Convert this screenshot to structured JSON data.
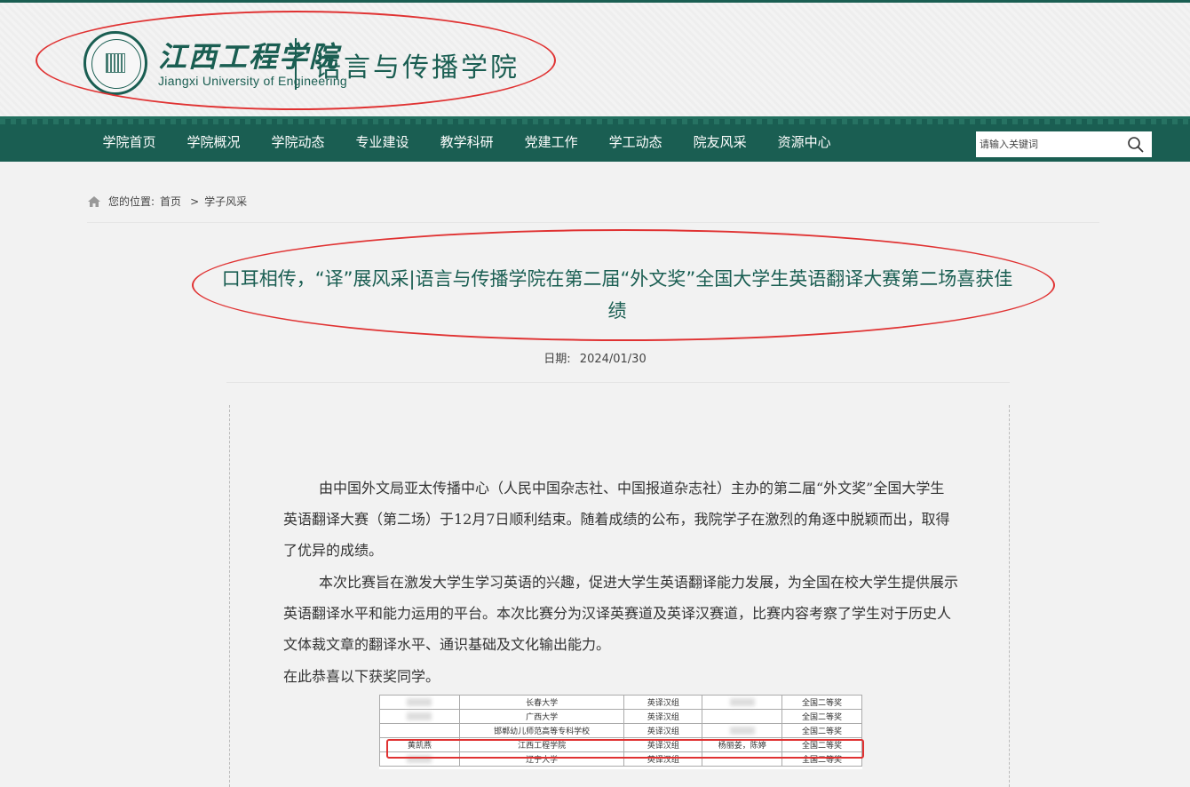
{
  "header": {
    "university_cn": "江西工程学院",
    "university_en": "Jiangxi University of Engineering",
    "college_name": "语言与传播学院"
  },
  "nav": {
    "items": [
      "学院首页",
      "学院概况",
      "学院动态",
      "专业建设",
      "教学科研",
      "党建工作",
      "学工动态",
      "院友风采",
      "资源中心"
    ]
  },
  "search": {
    "placeholder": "请输入关键词"
  },
  "breadcrumb": {
    "label": "您的位置:",
    "home": "首页",
    "separator": ">",
    "current": "学子风采"
  },
  "article": {
    "title": "口耳相传，“译”展风采|语言与传播学院在第二届“外文奖”全国大学生英语翻译大赛第二场喜获佳绩",
    "date_label": "日期:",
    "date": "2024/01/30",
    "paragraphs": [
      "由中国外文局亚太传播中心（人民中国杂志社、中国报道杂志社）主办的第二届“外文奖”全国大学生英语翻译大赛（第二场）于12月7日顺利结束。随着成绩的公布，我院学子在激烈的角逐中脱颖而出，取得了优异的成绩。",
      "本次比赛旨在激发大学生学习英语的兴趣，促进大学生英语翻译能力发展，为全国在校大学生提供展示英语翻译水平和能力运用的平台。本次比赛分为汉译英赛道及英译汉赛道，比赛内容考察了学生对于历史人文体裁文章的翻译水平、通识基础及文化输出能力。",
      "在此恭喜以下获奖同学。"
    ]
  },
  "award_table": {
    "rows": [
      {
        "name": "",
        "school": "长春大学",
        "track": "英译汉组",
        "teacher": "",
        "award": "全国二等奖"
      },
      {
        "name": "",
        "school": "广西大学",
        "track": "英译汉组",
        "teacher": "",
        "award": "全国二等奖"
      },
      {
        "name": "",
        "school": "邯郸幼儿师范高等专科学校",
        "track": "英译汉组",
        "teacher": "",
        "award": "全国二等奖"
      },
      {
        "name": "黄凯燕",
        "school": "江西工程学院",
        "track": "英译汉组",
        "teacher": "杨丽姜，陈婷",
        "award": "全国二等奖"
      },
      {
        "name": "",
        "school": "辽宁大学",
        "track": "英译汉组",
        "teacher": "",
        "award": "全国二等奖"
      }
    ]
  },
  "colors": {
    "brand": "#1a5e52",
    "highlight": "#e03232"
  }
}
